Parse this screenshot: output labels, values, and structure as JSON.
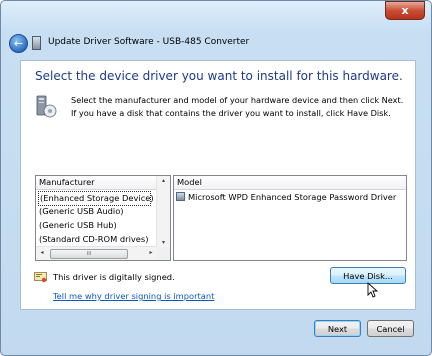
{
  "window": {
    "title": "Update Driver Software - USB-485 Converter",
    "close_glyph": "x"
  },
  "page": {
    "heading": "Select the device driver you want to install for this hardware.",
    "instructions": "Select the manufacturer and model of your hardware device and then click Next. If you have a disk that contains the driver you want to install, click Have Disk."
  },
  "manufacturer_list": {
    "header": "Manufacturer",
    "items": [
      "(Enhanced Storage Device)",
      "(Generic USB Audio)",
      "(Generic USB Hub)",
      "(Standard CD-ROM drives)"
    ],
    "selected_index": 0,
    "scroll_left_glyph": "◂",
    "scroll_right_glyph": "▸",
    "scroll_up_glyph": "▴",
    "scroll_down_glyph": "▾",
    "thumb_grip": "III"
  },
  "model_list": {
    "header": "Model",
    "items": [
      "Microsoft WPD Enhanced Storage Password Driver"
    ]
  },
  "signing": {
    "status": "This driver is digitally signed.",
    "link": "Tell me why driver signing is important"
  },
  "buttons": {
    "have_disk": "Have Disk...",
    "next": "Next",
    "cancel": "Cancel"
  },
  "colors": {
    "heading": "#1e3b8a",
    "link": "#0b58c3",
    "frame": "#c8dff3"
  }
}
